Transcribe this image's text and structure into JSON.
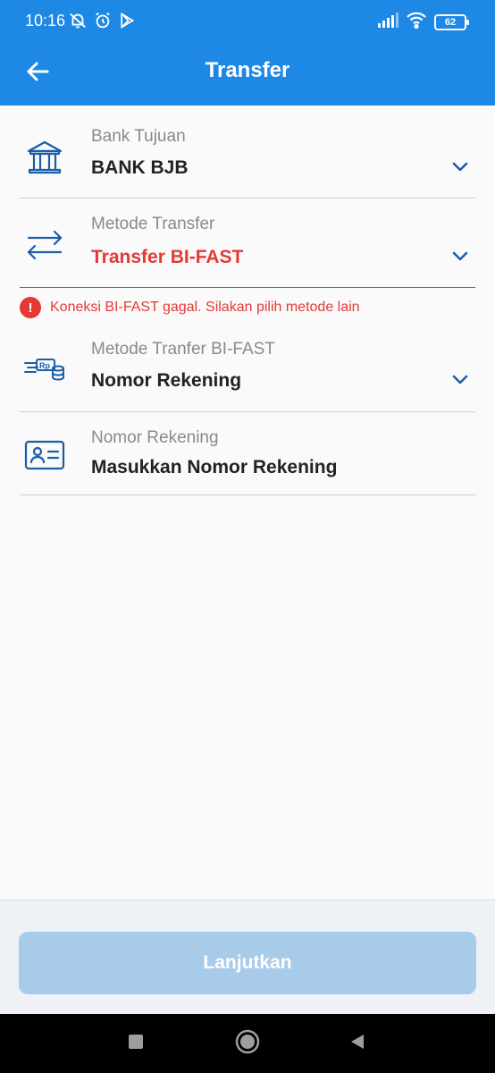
{
  "status_bar": {
    "time": "10:16",
    "battery": "62",
    "icons_left": [
      "alarm-off-icon",
      "alarm-clock-icon",
      "play-store-icon"
    ],
    "icons_right": [
      "signal-icon",
      "wifi-icon",
      "battery-icon"
    ]
  },
  "app_bar": {
    "title": "Transfer",
    "back_icon": "arrow-back-icon"
  },
  "fields": {
    "bank": {
      "label": "Bank Tujuan",
      "value": "BANK BJB",
      "icon": "bank-icon"
    },
    "method": {
      "label": "Metode Transfer",
      "value": "Transfer BI-FAST",
      "icon": "transfer-arrows-icon"
    },
    "sub_method": {
      "label": "Metode Tranfer BI-FAST",
      "value": "Nomor Rekening",
      "icon": "money-transfer-icon"
    },
    "account": {
      "label": "Nomor Rekening",
      "value": "Masukkan Nomor Rekening",
      "icon": "id-card-icon"
    }
  },
  "error": {
    "message": "Koneksi BI-FAST gagal. Silakan pilih metode lain",
    "icon_glyph": "!"
  },
  "action": {
    "continue_label": "Lanjutkan"
  },
  "colors": {
    "primary": "#1e88e5",
    "icon_blue": "#1a5da8",
    "error": "#e53935",
    "button_disabled": "#a9cbea"
  }
}
